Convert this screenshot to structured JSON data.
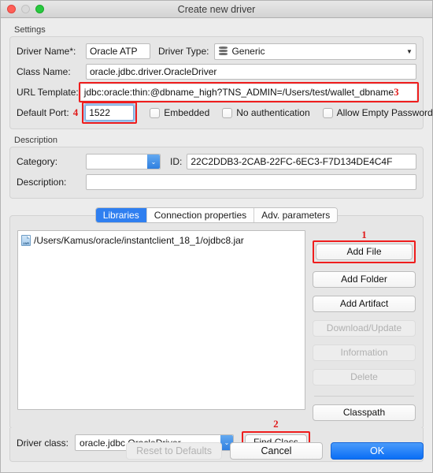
{
  "window": {
    "title": "Create new driver",
    "traffic_lights": [
      "close-red",
      "minimize-disabled",
      "zoom-green"
    ]
  },
  "settings": {
    "group_label": "Settings",
    "driver_name_label": "Driver Name*:",
    "driver_name_value": "Oracle ATP",
    "driver_type_label": "Driver Type:",
    "driver_type_value": "Generic",
    "driver_type_icon": "database-icon",
    "class_name_label": "Class Name:",
    "class_name_value": "oracle.jdbc.driver.OracleDriver",
    "url_template_label": "URL Template:",
    "url_template_value": "jdbc:oracle:thin:@dbname_high?TNS_ADMIN=/Users/test/wallet_dbname",
    "url_template_anno": "3",
    "default_port_label": "Default Port:",
    "default_port_anno": "4",
    "default_port_value": "1522",
    "checkboxes": [
      {
        "label": "Embedded",
        "checked": false
      },
      {
        "label": "No authentication",
        "checked": false
      },
      {
        "label": "Allow Empty Password",
        "checked": false
      }
    ]
  },
  "description": {
    "group_label": "Description",
    "category_label": "Category:",
    "category_value": "",
    "id_label": "ID:",
    "id_value": "22C2DDB3-2CAB-22FC-6EC3-F7D134DE4C4F",
    "description_label": "Description:",
    "description_value": ""
  },
  "tabs": [
    {
      "label": "Libraries",
      "active": true
    },
    {
      "label": "Connection properties",
      "active": false
    },
    {
      "label": "Adv. parameters",
      "active": false
    }
  ],
  "libraries": {
    "items": [
      {
        "icon": "jar-file-icon",
        "path": "/Users/Kamus/oracle/instantclient_18_1/ojdbc8.jar"
      }
    ],
    "add_file_anno": "1",
    "buttons": [
      {
        "label": "Add File",
        "enabled": true
      },
      {
        "label": "Add Folder",
        "enabled": true
      },
      {
        "label": "Add Artifact",
        "enabled": true
      },
      {
        "label": "Download/Update",
        "enabled": false
      },
      {
        "label": "Information",
        "enabled": false
      },
      {
        "label": "Delete",
        "enabled": false
      },
      {
        "label": "Classpath",
        "enabled": true
      }
    ]
  },
  "driver_class": {
    "label": "Driver class:",
    "value": "oracle.jdbc.OracleDriver",
    "find_class_label": "Find Class",
    "find_class_anno": "2"
  },
  "footer": {
    "reset_label": "Reset to Defaults",
    "cancel_label": "Cancel",
    "ok_label": "OK"
  },
  "colors": {
    "accent_blue": "#2f7ff0",
    "annotation_red": "#e01b1b",
    "window_bg": "#ececec"
  }
}
